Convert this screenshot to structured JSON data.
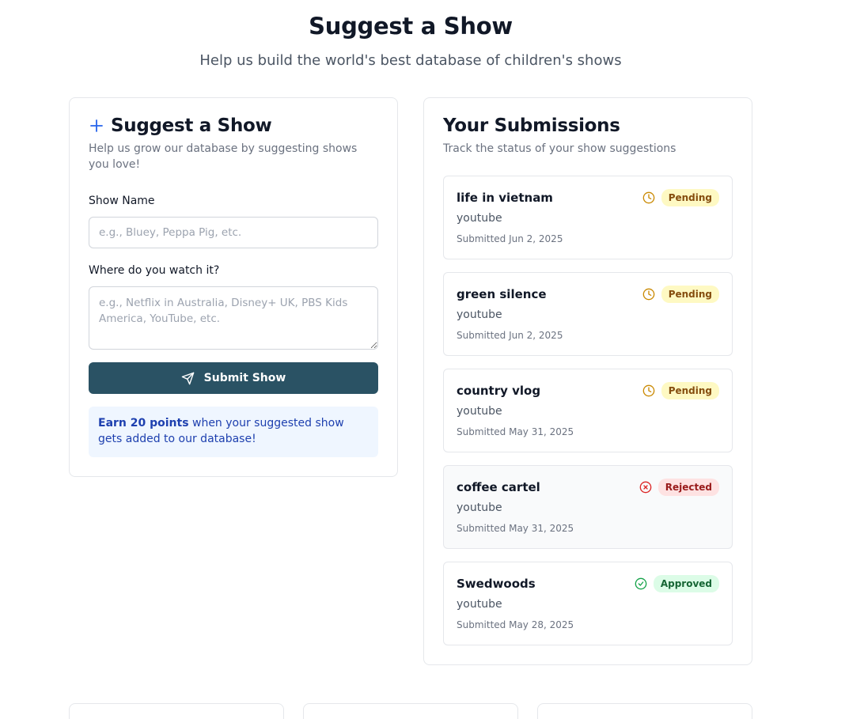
{
  "header": {
    "title": "Suggest a Show",
    "subtitle": "Help us build the world's best database of children's shows"
  },
  "form": {
    "title": "Suggest a Show",
    "description": "Help us grow our database by suggesting shows you love!",
    "show_name_label": "Show Name",
    "show_name_placeholder": "e.g., Bluey, Peppa Pig, etc.",
    "show_name_value": "",
    "where_label": "Where do you watch it?",
    "where_placeholder": "e.g., Netflix in Australia, Disney+ UK, PBS Kids America, YouTube, etc.",
    "where_value": "",
    "submit_label": "Submit Show",
    "info_bold": "Earn 20 points",
    "info_rest": " when your suggested show gets added to our database!"
  },
  "submissions": {
    "title": "Your Submissions",
    "description": "Track the status of your show suggestions",
    "items": [
      {
        "name": "life in vietnam",
        "platform": "youtube",
        "date": "Submitted Jun 2, 2025",
        "status": "Pending",
        "status_icon": "clock-icon"
      },
      {
        "name": "green silence",
        "platform": "youtube",
        "date": "Submitted Jun 2, 2025",
        "status": "Pending",
        "status_icon": "clock-icon"
      },
      {
        "name": "country vlog",
        "platform": "youtube",
        "date": "Submitted May 31, 2025",
        "status": "Pending",
        "status_icon": "clock-icon"
      },
      {
        "name": "coffee cartel",
        "platform": "youtube",
        "date": "Submitted May 31, 2025",
        "status": "Rejected",
        "status_icon": "x-circle-icon"
      },
      {
        "name": "Swedwoods",
        "platform": "youtube",
        "date": "Submitted May 28, 2025",
        "status": "Approved",
        "status_icon": "check-circle-icon"
      }
    ]
  },
  "colors": {
    "primary_button": "#2a5264",
    "accent_blue": "#2563eb",
    "pending": "#ca8a04",
    "rejected": "#dc2626",
    "approved": "#16a34a"
  }
}
